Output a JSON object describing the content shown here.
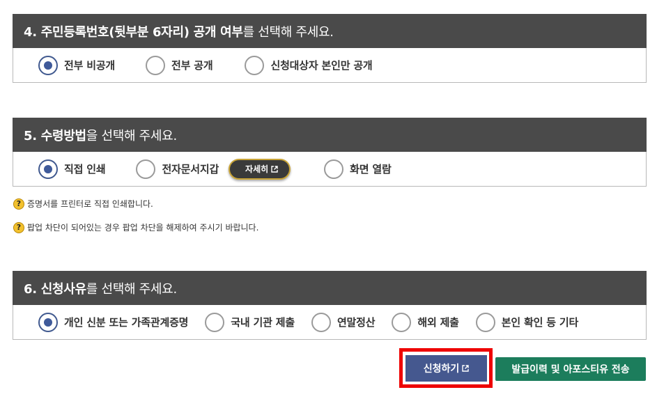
{
  "section4": {
    "title_bold": "4. 주민등록번호(뒷부분 6자리) 공개 여부",
    "title_rest": "를 선택해 주세요.",
    "options": [
      {
        "label": "전부 비공개",
        "selected": true
      },
      {
        "label": "전부 공개",
        "selected": false
      },
      {
        "label": "신청대상자 본인만 공개",
        "selected": false
      }
    ]
  },
  "section5": {
    "title_bold": "5. 수령방법",
    "title_rest": "을 선택해 주세요.",
    "options": [
      {
        "label": "직접 인쇄",
        "selected": true
      },
      {
        "label": "전자문서지갑",
        "selected": false
      },
      {
        "label": "화면 열람",
        "selected": false
      }
    ],
    "detail_button": "자세히"
  },
  "notes": [
    "증명서를 프린터로 직접 인쇄합니다.",
    "팝업 차단이 되어있는 경우 팝업 차단을 해제하여 주시기 바랍니다."
  ],
  "section6": {
    "title_bold": "6. 신청사유",
    "title_rest": "를 선택해 주세요.",
    "options": [
      {
        "label": "개인 신분 또는 가족관계증명",
        "selected": true
      },
      {
        "label": "국내 기관 제출",
        "selected": false
      },
      {
        "label": "연말정산",
        "selected": false
      },
      {
        "label": "해외 제출",
        "selected": false
      },
      {
        "label": "본인 확인 등 기타",
        "selected": false
      }
    ]
  },
  "buttons": {
    "apply": "신청하기",
    "history": "발급이력 및 아포스티유 전송"
  },
  "colors": {
    "header_bg": "#4a4a4a",
    "radio_selected": "#3f5a9a",
    "apply_bg": "#45588f",
    "history_bg": "#1c7d5c",
    "highlight": "#ee0000",
    "help_icon": "#f2c12e"
  },
  "icons": {
    "external_link": "external-link-icon",
    "help": "question-circle-icon"
  }
}
